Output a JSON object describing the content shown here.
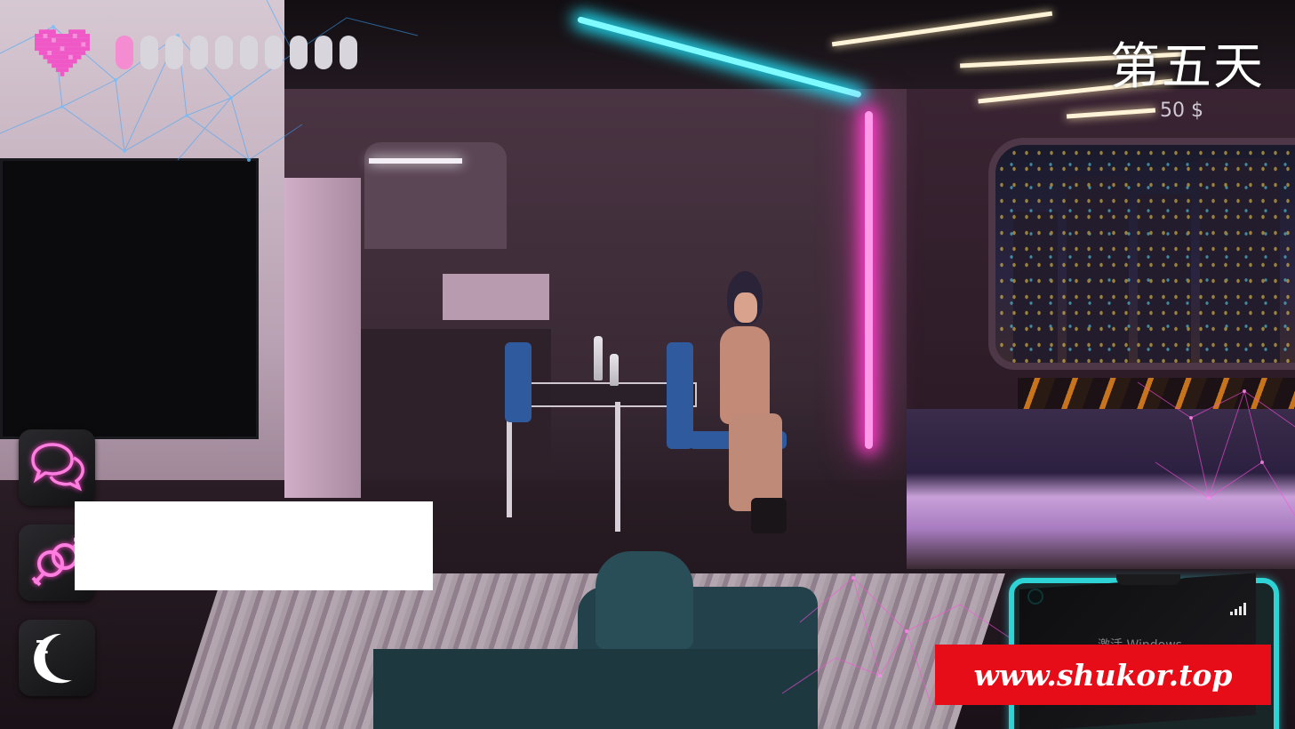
{
  "hud": {
    "heart_icon": "pixel-heart-icon",
    "love_meter": {
      "filled": 1,
      "total": 10,
      "filled_color": "#f58bd1",
      "empty_color": "#d8d6dc"
    },
    "day": "第五天",
    "money": "50 $"
  },
  "actions": [
    {
      "id": "chat",
      "icon": "chat-bubbles-icon"
    },
    {
      "id": "love",
      "icon": "gender-symbols-icon"
    },
    {
      "id": "sleep",
      "icon": "moon-sleep-icon",
      "glyph": "Z"
    }
  ],
  "phone": {
    "signal_icon": "signal-bars-icon",
    "screen_text": "激活 Windows"
  },
  "watermark": {
    "text": "www.shukor.top",
    "color": "#e70d18"
  },
  "colors": {
    "neon_pink": "#ff3fc8",
    "neon_cyan": "#1fe8ff",
    "phone_frame": "#2ed3d6"
  }
}
